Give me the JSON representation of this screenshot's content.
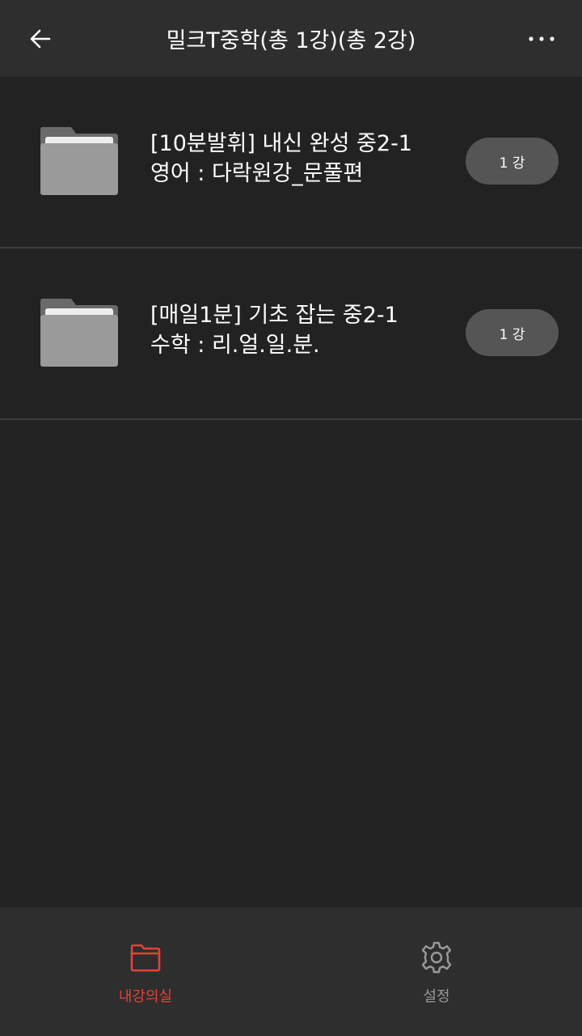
{
  "header": {
    "title": "밀크T중학(총 1강)(총 2강)",
    "back_icon": "arrow-left-icon",
    "more_icon": "more-horizontal-icon"
  },
  "items": [
    {
      "title_line1": "[10분발휘] 내신 완성 중2-1",
      "title_line2": "영어 : 다락원강_문풀편",
      "count": "1 강",
      "icon": "folder-icon"
    },
    {
      "title_line1": "[매일1분] 기초 잡는 중2-1",
      "title_line2": "수학 : 리.얼.일.분.",
      "count": "1 강",
      "icon": "folder-icon"
    }
  ],
  "bottom_nav": {
    "tabs": [
      {
        "label": "내강의실",
        "icon": "folder-icon",
        "active": true
      },
      {
        "label": "설정",
        "icon": "gear-icon",
        "active": false
      }
    ]
  },
  "colors": {
    "background": "#222222",
    "bar": "#2e2e2e",
    "accent": "#e2423a",
    "pill": "#555555"
  }
}
